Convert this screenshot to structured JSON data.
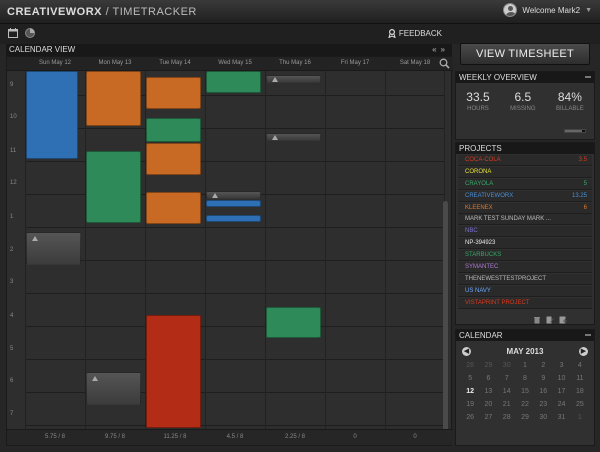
{
  "app": {
    "brand": "CREATIVEWORX",
    "brand_sub": "/ TIMETRACKER",
    "welcome": "Welcome Mark2"
  },
  "toolbar": {
    "feedback_label": "FEEDBACK",
    "icons": [
      "calendar-icon",
      "clock-icon",
      "feedback-icon"
    ]
  },
  "calendar_view": {
    "title": "CALENDAR VIEW",
    "days": [
      "Sun May 12",
      "Mon May 13",
      "Tue May 14",
      "Wed May 15",
      "Thu May 16",
      "Fri May 17",
      "Sat May 18"
    ],
    "hours": [
      "9",
      "10",
      "11",
      "12",
      "1",
      "2",
      "3",
      "4",
      "5",
      "6",
      "7"
    ],
    "totals": [
      "5.75 / 8",
      "9.75 / 8",
      "11.25 / 8",
      "4.5 / 8",
      "2.25 / 8",
      "0",
      "0"
    ],
    "colors": {
      "blue": "#2f6fb3",
      "orange": "#c86a24",
      "green": "#2f8a5a",
      "red": "#b32d16",
      "grey": "#4a4a4a"
    }
  },
  "sidebar": {
    "view_timesheet": "VIEW TIMESHEET",
    "weekly_overview": {
      "title": "WEEKLY OVERVIEW",
      "hours_value": "33.5",
      "hours_label": "HOURS",
      "missing_value": "6.5",
      "missing_label": "MISSING",
      "billable_value": "84%",
      "billable_label": "BILLABLE",
      "billable_fraction": 0.84
    },
    "projects": {
      "title": "PROJECTS",
      "items": [
        {
          "name": "COCA-COLA",
          "count": "3.5",
          "color": "#d63a1e"
        },
        {
          "name": "CORONA",
          "count": "",
          "color": "#e8e23a"
        },
        {
          "name": "CRAYOLA",
          "count": "5",
          "color": "#3aa868"
        },
        {
          "name": "CREATIVEWORX",
          "count": "13.25",
          "color": "#4a8fd6"
        },
        {
          "name": "KLEENEX",
          "count": "6",
          "color": "#e0782a"
        },
        {
          "name": "MARK TEST SUNDAY MARK ...",
          "count": "",
          "color": "#bbbbbb"
        },
        {
          "name": "NBC",
          "count": "",
          "color": "#7b6fd6"
        },
        {
          "name": "NP-394923",
          "count": "",
          "color": "#e8e8e8"
        },
        {
          "name": "STARBUCKS",
          "count": "",
          "color": "#3aa868"
        },
        {
          "name": "SYMANTEC",
          "count": "",
          "color": "#b07ad6"
        },
        {
          "name": "THENEWESTTESTPROJECT",
          "count": "",
          "color": "#bbbbbb"
        },
        {
          "name": "US NAVY",
          "count": "",
          "color": "#6aa8ff"
        },
        {
          "name": "VISTAPRINT PROJECT",
          "count": "",
          "color": "#d63a1e"
        }
      ]
    },
    "calendar": {
      "title": "CALENDAR",
      "month": "MAY 2013",
      "weeks": [
        [
          "28",
          "29",
          "30",
          "1",
          "2",
          "3",
          "4"
        ],
        [
          "5",
          "6",
          "7",
          "8",
          "9",
          "10",
          "11"
        ],
        [
          "12",
          "13",
          "14",
          "15",
          "16",
          "17",
          "18"
        ],
        [
          "19",
          "20",
          "21",
          "22",
          "23",
          "24",
          "25"
        ],
        [
          "26",
          "27",
          "28",
          "29",
          "30",
          "31",
          "1"
        ]
      ],
      "selected": "12"
    }
  }
}
